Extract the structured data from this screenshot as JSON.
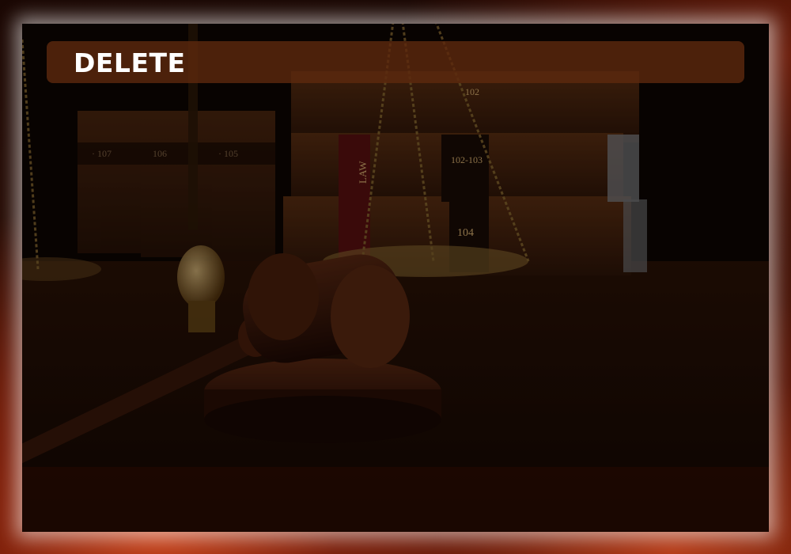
{
  "dialog": {
    "title": "DELETE"
  },
  "background": {
    "scene_description_icons": [
      "gavel-icon",
      "scales-of-justice-icon",
      "law-books-icon"
    ],
    "book_spine_labels": [
      "LAW",
      "104",
      "102-103",
      "102",
      "107",
      "106",
      "105"
    ],
    "colors": {
      "panel": "#0c0503",
      "title_bar": "#5c280e",
      "title_text": "#ffffff",
      "glow_border": "#ffffff",
      "fire_accent": "#c8421a"
    }
  }
}
